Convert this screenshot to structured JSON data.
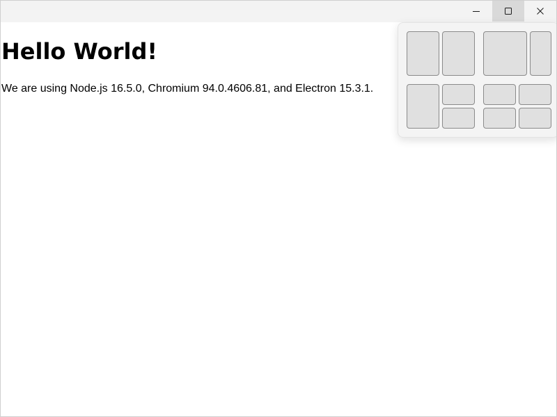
{
  "window": {
    "caption_buttons": [
      {
        "name": "minimize",
        "icon": "minimize-icon"
      },
      {
        "name": "maximize",
        "icon": "maximize-icon",
        "state": "hover"
      },
      {
        "name": "close",
        "icon": "close-icon"
      }
    ],
    "hover_color": "#d9d9d9"
  },
  "page": {
    "heading": "Hello World!",
    "info": "We are using Node.js 16.5.0, Chromium 94.0.4606.81, and Electron 15.3.1."
  },
  "snap_layouts": {
    "layouts": [
      {
        "name": "two-columns-equal",
        "zones": 2
      },
      {
        "name": "two-columns-wide-narrow",
        "zones": 2
      },
      {
        "name": "left-column-right-stacked",
        "zones": 3
      },
      {
        "name": "grid-quadrants",
        "zones": 4
      }
    ]
  }
}
